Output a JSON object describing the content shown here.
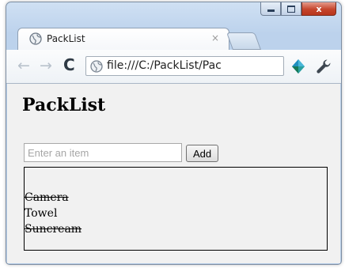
{
  "tab": {
    "title": "PackList",
    "close_glyph": "×",
    "favicon": "globe-icon"
  },
  "window_controls": {
    "close_glyph": "x"
  },
  "toolbar": {
    "back_glyph": "←",
    "forward_glyph": "→",
    "reload_glyph": "C",
    "address": "file:///C:/PackList/Pac",
    "extension_icon": "extension-icon",
    "menu_icon": "wrench-icon"
  },
  "page": {
    "title": "PackList",
    "input": {
      "value": "",
      "placeholder": "Enter an item"
    },
    "add_label": "Add",
    "items": [
      {
        "text": "Camera",
        "done": true
      },
      {
        "text": "Towel",
        "done": false
      },
      {
        "text": "Suncream",
        "done": true
      }
    ]
  },
  "colors": {
    "window_frame": "#bcd2ec",
    "page_background": "#f1f1f1",
    "close_button": "#c5452c"
  }
}
